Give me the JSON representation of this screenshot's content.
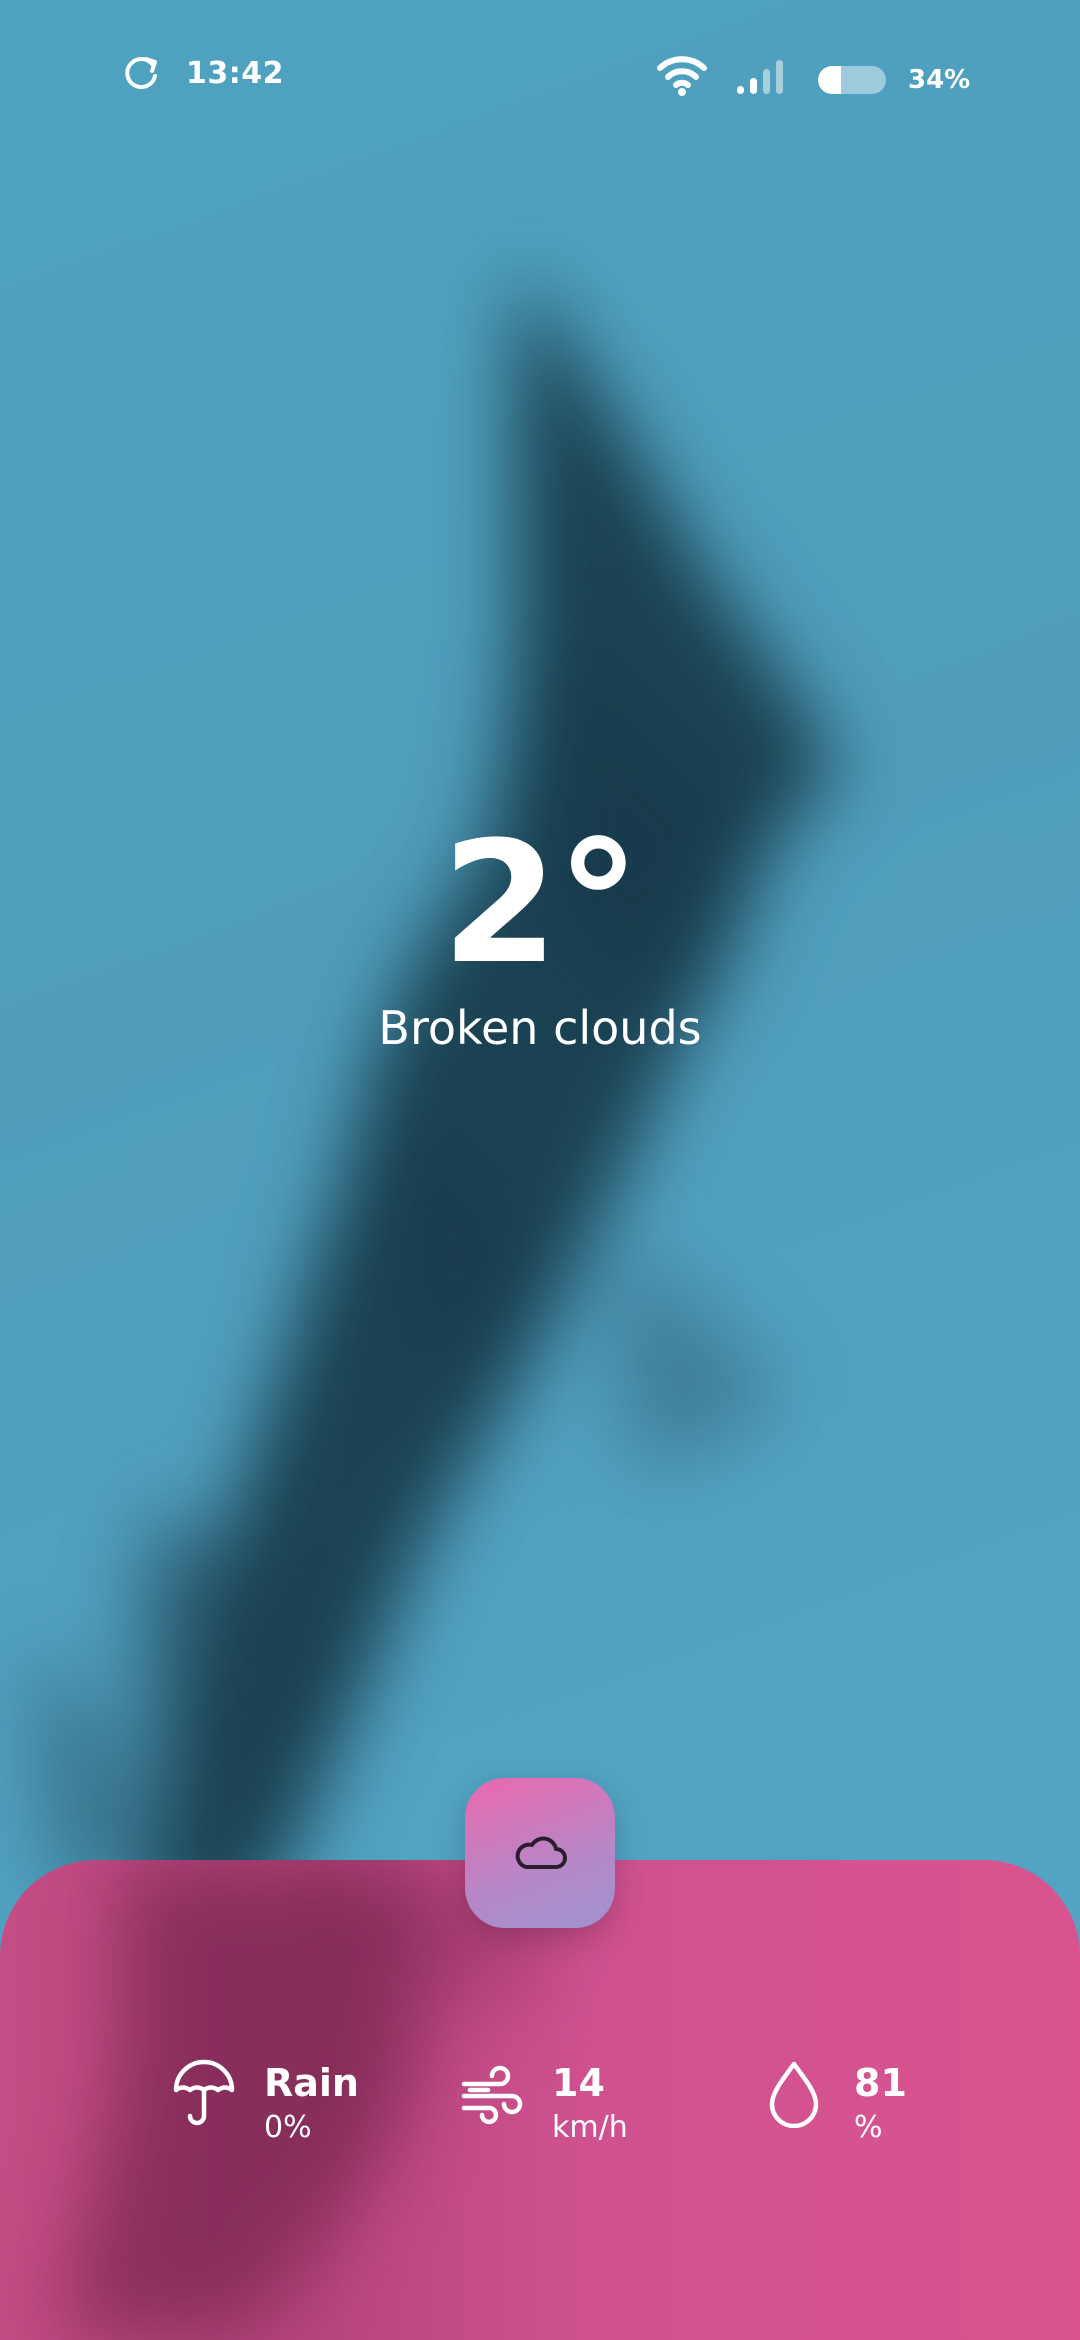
{
  "status_bar": {
    "time": "13:42",
    "battery_percent_text": "34%",
    "battery_level": 0.34,
    "refresh_icon": "refresh-icon",
    "wifi_icon": "wifi-icon",
    "signal_icon": "signal-icon"
  },
  "weather": {
    "temperature": "2°",
    "condition": "Broken clouds"
  },
  "fab": {
    "icon": "cloud-icon"
  },
  "stats": [
    {
      "icon": "umbrella-icon",
      "value": "Rain",
      "unit": "0%"
    },
    {
      "icon": "wind-icon",
      "value": "14",
      "unit": "km/h"
    },
    {
      "icon": "droplet-icon",
      "value": "81",
      "unit": "%"
    }
  ],
  "colors": {
    "sky": "#4f9dbb",
    "sheet": "#cf5190",
    "fab_top": "#ec68ae",
    "fab_bottom": "#9f93d0",
    "text": "#ffffff"
  }
}
